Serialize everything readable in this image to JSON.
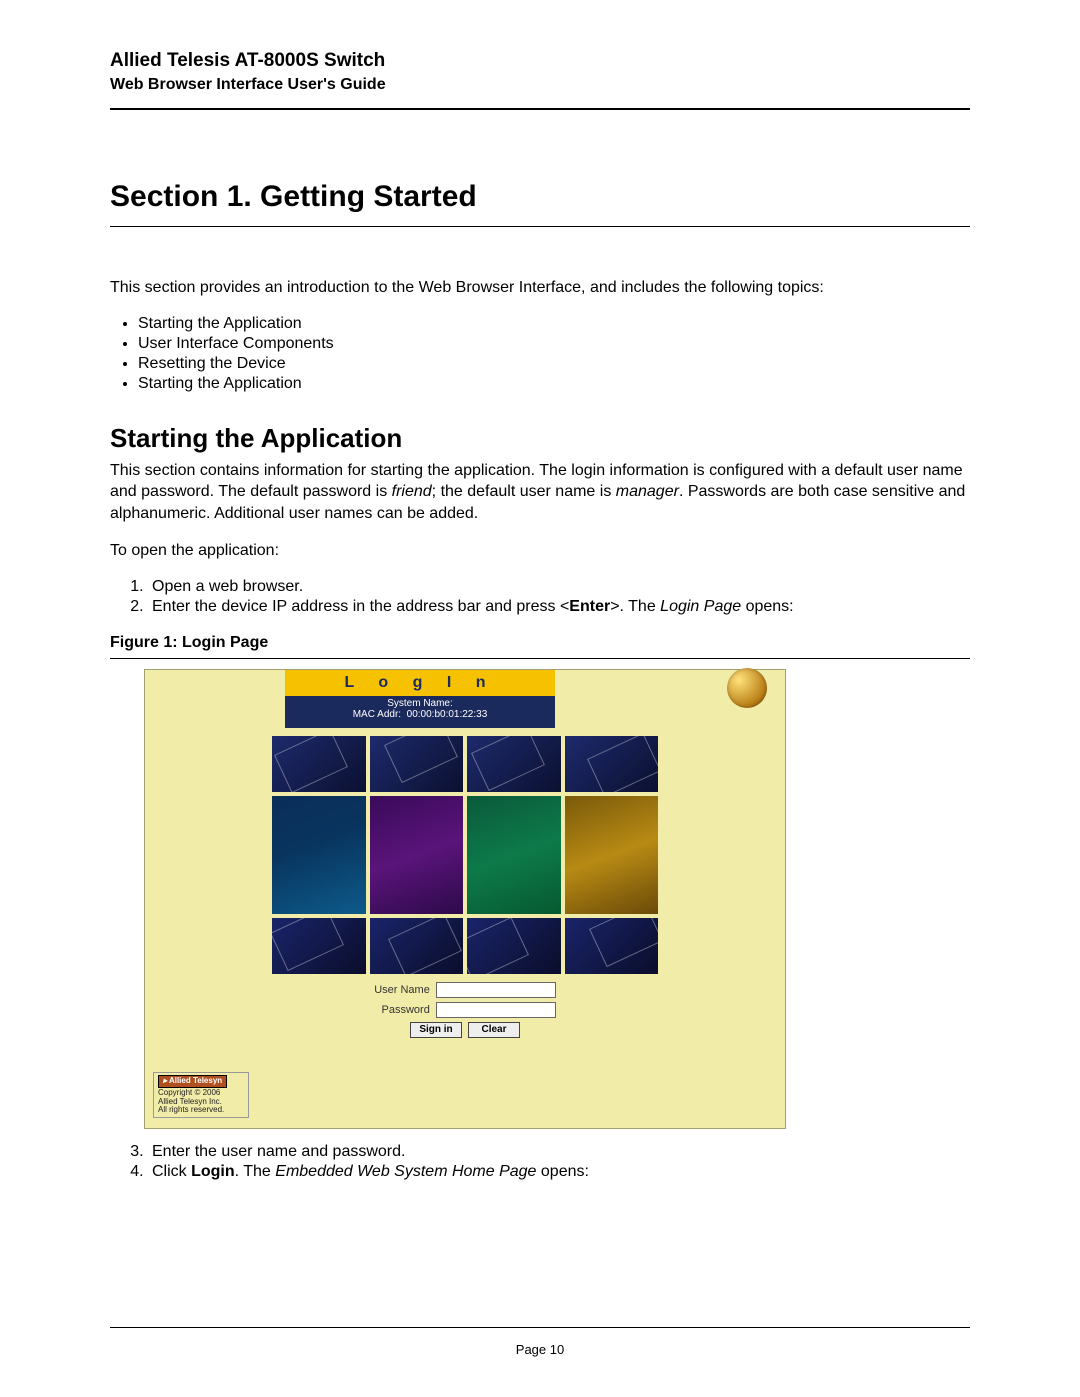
{
  "header": {
    "title": "Allied Telesis AT-8000S Switch",
    "subtitle": "Web Browser Interface User's Guide"
  },
  "section_title": "Section 1.  Getting Started",
  "intro_para": "This section provides an introduction to the Web Browser Interface, and includes the following topics:",
  "topics": [
    "Starting the Application",
    "User Interface Components",
    "Resetting the Device",
    "Starting the Application"
  ],
  "h2": "Starting the Application",
  "h2_para_parts": {
    "p1": "This section contains information for starting the application. The login information is configured with a default user name and password. The default password is ",
    "p2": "friend",
    "p3": "; the default user name is ",
    "p4": "manager",
    "p5": ". Passwords are both case sensitive and alphanumeric. Additional user names can be added."
  },
  "to_open": "To open the application:",
  "steps12": {
    "s1": "Open a web browser.",
    "s2a": "Enter the device IP address in the address bar and press <",
    "s2b": "Enter",
    "s2c": ">. The ",
    "s2d": "Login Page",
    "s2e": " opens:"
  },
  "figure_caption": "Figure 1:    Login Page",
  "login": {
    "banner": "L o g  I n",
    "sys_name_label": "System Name:",
    "mac_label": "MAC Addr:",
    "mac_value": "00:00:b0:01:22:33",
    "user_label": "User Name",
    "pass_label": "Password",
    "signin": "Sign in",
    "clear": "Clear",
    "logo": "Allied Telesyn",
    "copyright": "Copyright © 2006",
    "company": "Allied Telesyn Inc.",
    "rights": "All rights reserved."
  },
  "steps34": {
    "s3": "Enter the user name and password.",
    "s4a": "Click ",
    "s4b": "Login",
    "s4c": ". The ",
    "s4d": "Embedded Web System Home Page",
    "s4e": " opens:"
  },
  "page_number": "Page 10"
}
